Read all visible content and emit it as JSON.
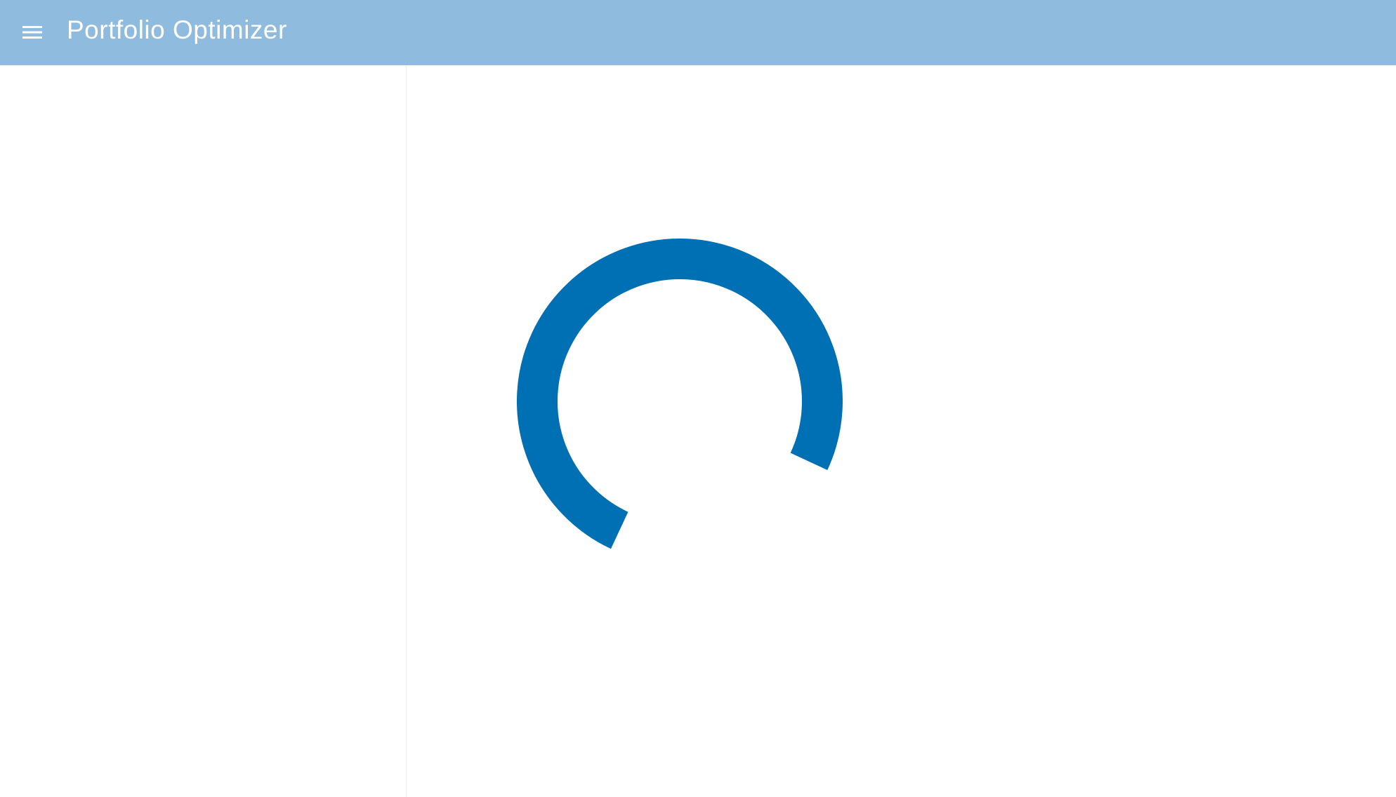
{
  "appbar": {
    "title": "Portfolio Optimizer",
    "menu_icon": "hamburger-menu-icon",
    "background_color": "#8fbbde",
    "title_color": "#ffffff"
  },
  "loading": {
    "spinner_color": "#0070b5",
    "progress_fraction": 0.75
  }
}
